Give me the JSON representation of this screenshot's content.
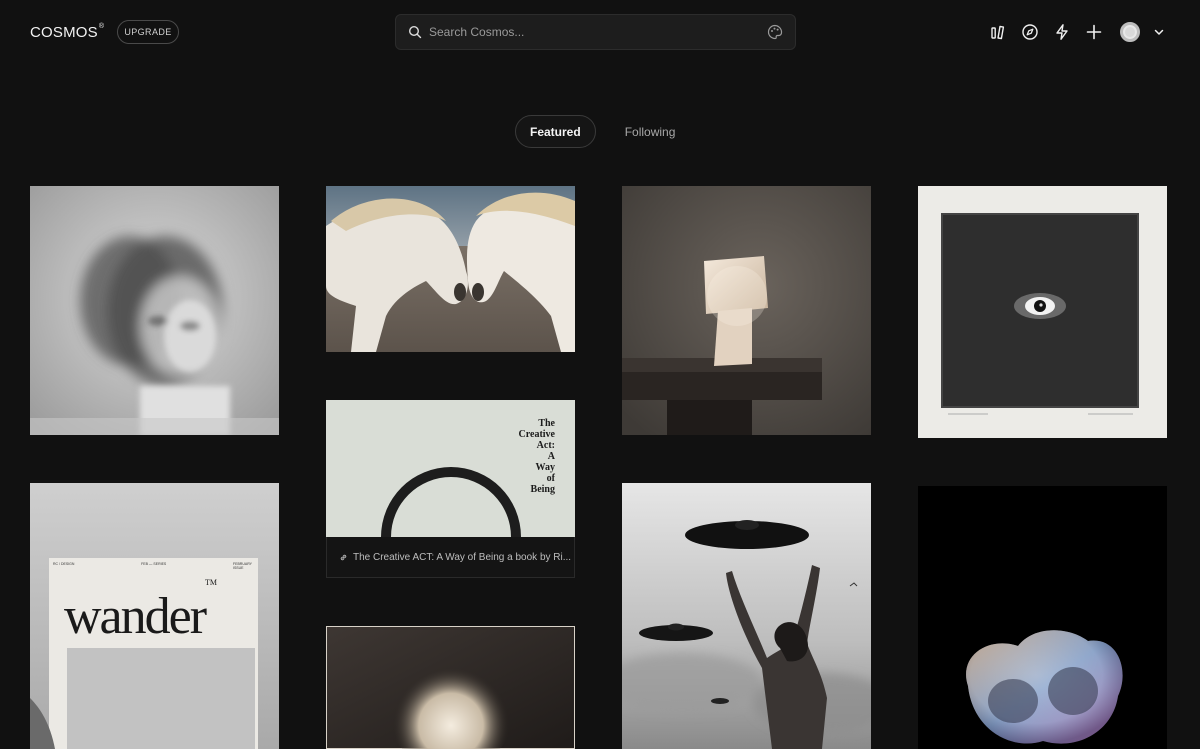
{
  "header": {
    "logo_text": "COSMOS",
    "logo_mark": "®",
    "upgrade_label": "UPGRADE",
    "search_placeholder": "Search Cosmos...",
    "icons": [
      "search-icon",
      "palette-icon",
      "library-icon",
      "compass-icon",
      "bolt-icon",
      "plus-icon",
      "avatar",
      "chevron-down-icon"
    ]
  },
  "tabs": [
    {
      "label": "Featured",
      "active": true
    },
    {
      "label": "Following",
      "active": false
    }
  ],
  "feed": {
    "items": [
      {
        "name": "blurred-portrait-image"
      },
      {
        "name": "white-horses-image"
      },
      {
        "name": "alabaster-lamp-image"
      },
      {
        "name": "eye-drawing-image"
      },
      {
        "name": "wander-poster-image",
        "visible_text": [
          "wander",
          "TM",
          "RC / DESIGN",
          "FEB — SERIES",
          "FEBRUARY ISSUE"
        ]
      },
      {
        "name": "creative-act-book-image",
        "visible_text": [
          "The",
          "Creative",
          "Act:",
          "A",
          "Way",
          "of",
          "Being"
        ],
        "caption": "The Creative ACT: A Way of Being a book by Ri..."
      },
      {
        "name": "ufo-photo-image"
      },
      {
        "name": "iridescent-sphere-image"
      },
      {
        "name": "glowing-sphere-image"
      }
    ]
  },
  "colors": {
    "background": "#111111",
    "search_bg": "#1d1d1d",
    "text": "#e8e8e8",
    "muted": "#a8a8a8"
  }
}
